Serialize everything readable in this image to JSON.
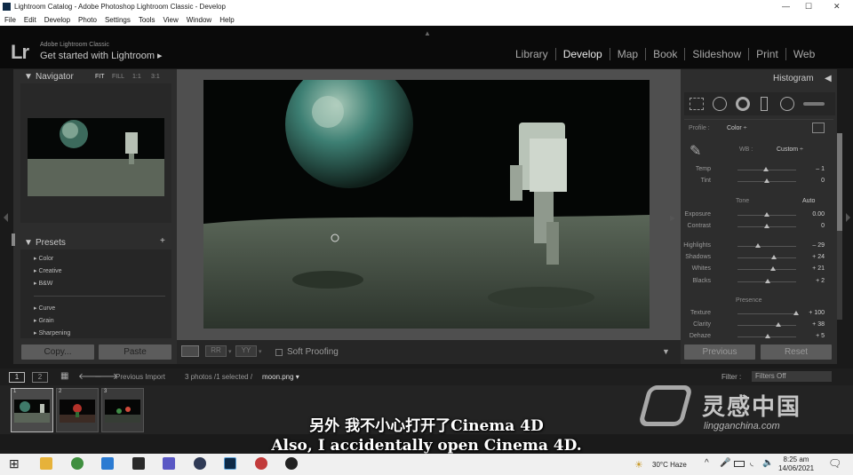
{
  "window": {
    "title": "Lightroom Catalog - Adobe Photoshop Lightroom Classic - Develop"
  },
  "menu": [
    "File",
    "Edit",
    "Develop",
    "Photo",
    "Settings",
    "Tools",
    "View",
    "Window",
    "Help"
  ],
  "identity": {
    "logo": "Lr",
    "line1": "Adobe Lightroom Classic",
    "line2": "Get started with Lightroom ▸"
  },
  "modules": [
    "Library",
    "Develop",
    "Map",
    "Book",
    "Slideshow",
    "Print",
    "Web"
  ],
  "active_module": "Develop",
  "navigator": {
    "title": "Navigator",
    "zooms": [
      "FIT",
      "FILL",
      "1:1",
      "3:1"
    ]
  },
  "presets": {
    "title": "Presets",
    "groups1": [
      "Color",
      "Creative",
      "B&W"
    ],
    "groups2": [
      "Curve",
      "Grain",
      "Sharpening"
    ]
  },
  "left_buttons": {
    "copy": "Copy...",
    "paste": "Paste"
  },
  "toolbar": {
    "soft_proofing": "Soft Proofing"
  },
  "right": {
    "histogram": "Histogram",
    "profile_label": "Profile :",
    "profile_value": "Color ÷",
    "wb_label": "WB :",
    "wb_value": "Custom ÷",
    "tone_label": "Tone",
    "auto": "Auto",
    "presence_label": "Presence",
    "sliders": [
      {
        "label": "Temp",
        "value": "– 1",
        "pos": 0.48
      },
      {
        "label": "Tint",
        "value": "0",
        "pos": 0.5
      },
      {
        "label": "Exposure",
        "value": "0.00",
        "pos": 0.5
      },
      {
        "label": "Contrast",
        "value": "0",
        "pos": 0.5
      },
      {
        "label": "Highlights",
        "value": "– 29",
        "pos": 0.35
      },
      {
        "label": "Shadows",
        "value": "+ 24",
        "pos": 0.62
      },
      {
        "label": "Whites",
        "value": "+ 21",
        "pos": 0.6
      },
      {
        "label": "Blacks",
        "value": "+ 2",
        "pos": 0.51
      },
      {
        "label": "Texture",
        "value": "+ 100",
        "pos": 1.0
      },
      {
        "label": "Clarity",
        "value": "+ 38",
        "pos": 0.69
      },
      {
        "label": "Dehaze",
        "value": "+ 5",
        "pos": 0.52
      }
    ],
    "previous": "Previous",
    "reset": "Reset"
  },
  "filmstrip": {
    "pages": [
      "1",
      "2"
    ],
    "previous_import": "Previous Import",
    "info_prefix": "3 photos /1 selected /",
    "filename": "moon.png ▾",
    "filter_label": "Filter :",
    "filter_value": "Filters Off",
    "thumbs": [
      "1",
      "2",
      "3"
    ]
  },
  "subtitle": {
    "cn": "另外 我不小心打开了Cinema 4D",
    "en": "Also, I accidentally open Cinema 4D."
  },
  "watermark": {
    "cn": "灵感中国",
    "en": "lingganchina.com"
  },
  "taskbar": {
    "weather": "30°C  Haze",
    "time": "8:25 am",
    "date": "14/06/2021"
  },
  "colors": {
    "panel": "#2d2d2d",
    "background": "#1a1a1a",
    "accent": "#e8e8e8"
  }
}
